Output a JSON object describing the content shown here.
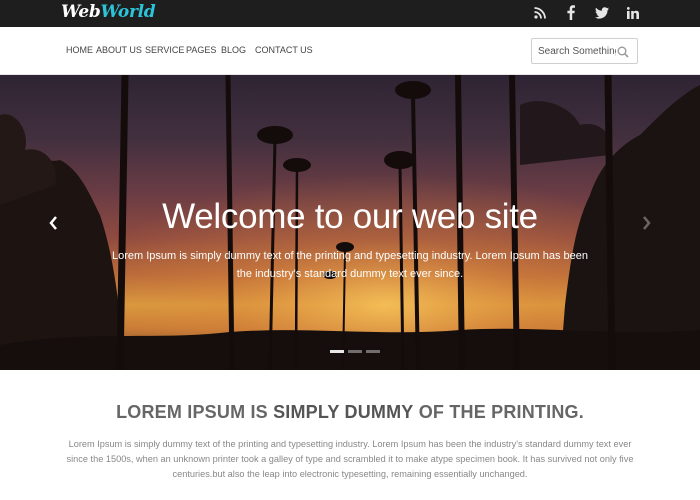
{
  "brand": {
    "part1": "Web",
    "part2": "World",
    "accent": "#2cc4d9"
  },
  "social": [
    {
      "name": "rss-icon"
    },
    {
      "name": "facebook-icon"
    },
    {
      "name": "twitter-icon"
    },
    {
      "name": "linkedin-icon"
    }
  ],
  "nav": {
    "items": [
      "HOME",
      "ABOUT US",
      "SERVICE",
      "PAGES",
      "BLOG",
      "CONTACT US"
    ]
  },
  "search": {
    "placeholder": "Search Something",
    "icon": "search-icon"
  },
  "hero": {
    "title": "Welcome to our web site",
    "text": "Lorem Ipsum is simply dummy text of the printing and typesetting industry. Lorem Ipsum has been the industry's standard dummy text ever since.",
    "prev_icon": "chevron-left-icon",
    "next_icon": "chevron-right-icon",
    "slides": 3,
    "active_slide": 1
  },
  "section": {
    "title_pre": "LOREM IPSUM IS ",
    "title_bold": "SIMPLY DUMMY",
    "title_post": " OF THE PRINTING.",
    "text": "Lorem Ipsum is simply dummy text of the printing and typesetting industry. Lorem Ipsum has been the industry's standard dummy text ever since the 1500s, when an unknown printer took a galley of type and scrambled it to make atype specimen book. It has survived not only five centuries.but also the leap into electronic typesetting, remaining essentially unchanged."
  }
}
